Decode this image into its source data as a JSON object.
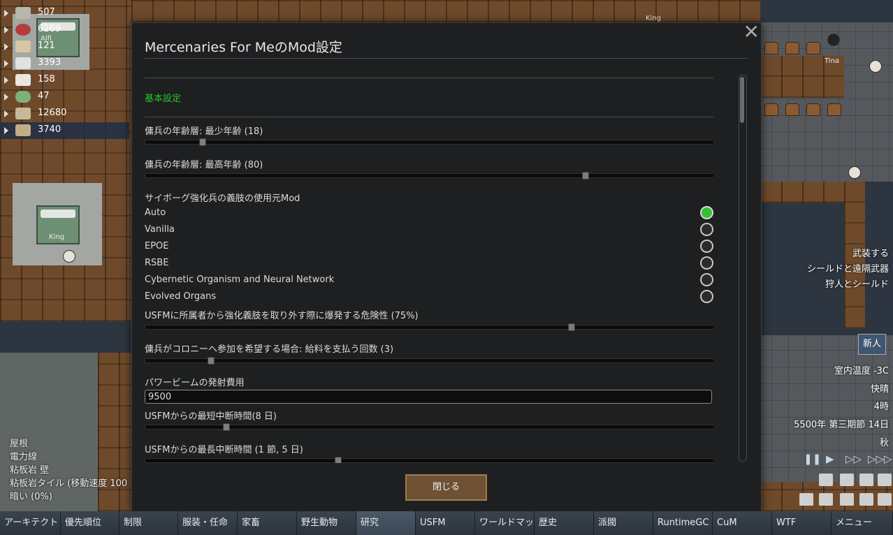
{
  "resources": [
    {
      "value": "507",
      "icon": "silver-icon",
      "color": "#b9b6ab"
    },
    {
      "value": "6269",
      "icon": "berries-icon",
      "color": "#b83b3b"
    },
    {
      "value": "121",
      "icon": "wood-log-icon",
      "color": "#d6c6a4"
    },
    {
      "value": "3393",
      "icon": "cloth-icon",
      "color": "#e1e1e1"
    },
    {
      "value": "158",
      "icon": "medicine-icon",
      "color": "#e9e6df"
    },
    {
      "value": "47",
      "icon": "pill-icon",
      "color": "#7fb07a"
    },
    {
      "value": "12680",
      "icon": "steel-icon",
      "color": "#c8b89b"
    },
    {
      "value": "3740",
      "icon": "chunk-icon",
      "color": "#c4ad84"
    }
  ],
  "world": {
    "pawn_labels": [
      "Alfi",
      "King",
      "King",
      "Tina"
    ]
  },
  "dialog": {
    "title": "Mercenaries For MeのMod設定",
    "section_header": "基本設定",
    "settings": {
      "min_age_label": "傭兵の年齢層: 最少年齢 (18)",
      "max_age_label": "傭兵の年齢層: 最高年齢 (80)",
      "cyborg_label": "サイボーグ強化兵の義肢の使用元Mod",
      "radio_options": [
        "Auto",
        "Vanilla",
        "EPOE",
        "RSBE",
        "Cybernetic Organism and Neural Network",
        "Evolved Organs"
      ],
      "radio_selected": "Auto",
      "explode_label": "USFMに所属者から強化義肢を取り外す際に爆発する危険性 (75%)",
      "salary_label": "傭兵がコロニーへ参加を希望する場合: 給料を支払う回数 (3)",
      "powerbeam_label": "パワービームの発射費用",
      "powerbeam_value": "9500",
      "min_break_label": "USFMからの最短中断時間(8 日)",
      "max_break_label": "USFMからの最長中断時間 (1 節, 5 日)"
    },
    "slider_values": {
      "min_age": 0.095,
      "max_age": 0.776,
      "explode": 0.75,
      "salary": 0.11,
      "min_break": 0.138,
      "max_break": 0.336
    },
    "close_button": "閉じる"
  },
  "right_panel": {
    "armed": "武装する",
    "shield_ranged": "シールドと遠隔武器",
    "hunter_shield": "狩人とシールド",
    "new_button": "新人",
    "temperature": "室内温度 -3C",
    "weather": "快晴",
    "time": "4時",
    "date": "5500年 第三期節 14日",
    "season": "秋"
  },
  "inspect": {
    "lines": [
      "屋根",
      "電力線",
      "粘板岩 壁",
      "粘板岩タイル (移動速度 100",
      "暗い (0%)"
    ]
  },
  "tabs": [
    "アーキテクト",
    "優先順位",
    "制限",
    "服装・任命",
    "家畜",
    "野生動物",
    "研究",
    "USFM",
    "ワールドマッ",
    "歴史",
    "派閥",
    "RuntimeGC",
    "CuM",
    "WTF",
    "メニュー"
  ],
  "active_tab": "研究"
}
